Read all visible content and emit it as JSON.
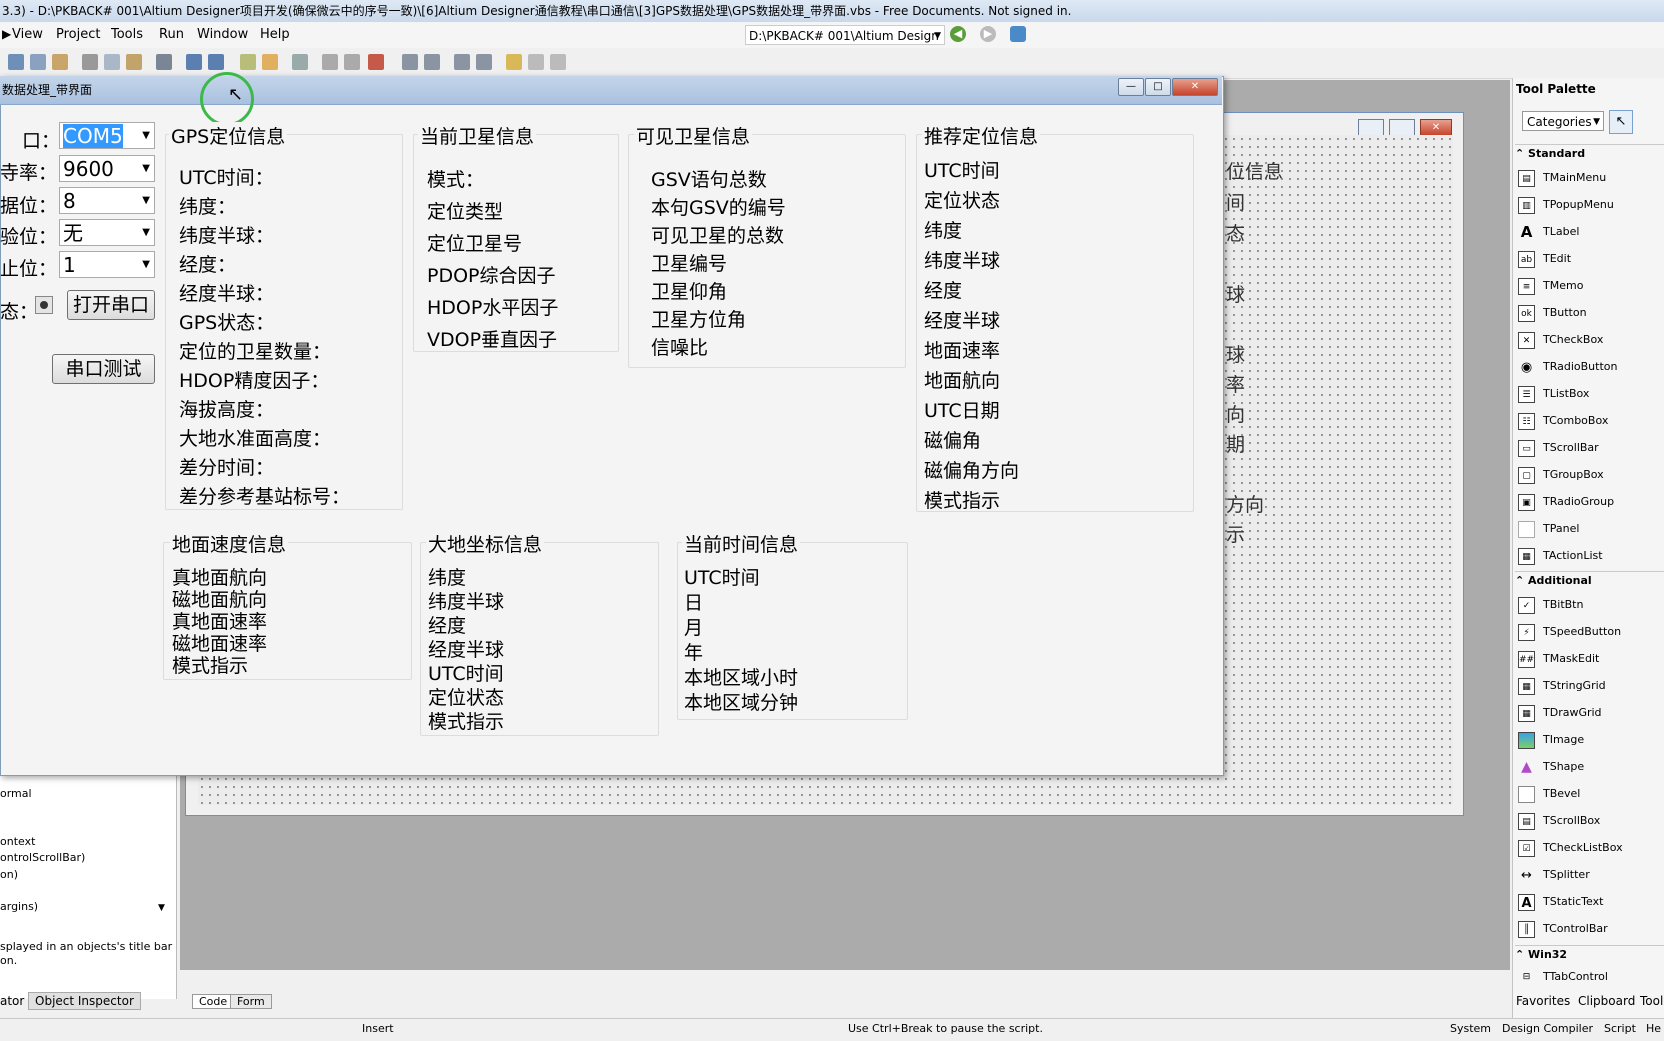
{
  "window": {
    "title": "3.3) - D:\\PKBACK# 001\\Altium Designer项目开发(确保微云中的序号一致)\\[6]Altium Designer通信教程\\串口通信\\[3]GPS数据处理\\GPS数据处理_带界面.vbs - Free Documents. Not signed in."
  },
  "menu": [
    "View",
    "Project",
    "Tools",
    "Run",
    "Window",
    "Help"
  ],
  "toolbar": {
    "path": "D:\\PKBACK# 001\\Altium Design"
  },
  "form": {
    "title": "数据处理_带界面",
    "serial": {
      "port_label": "口：",
      "port_value": "COM5",
      "baud_label": "寺率：",
      "baud_value": "9600",
      "data_label": "据位：",
      "data_value": "8",
      "check_label": "验位：",
      "check_value": "无",
      "stop_label": "止位：",
      "stop_value": "1",
      "state_label": "态：",
      "open_button": "打开串口",
      "test_button": "串口测试"
    },
    "groups": {
      "gps": {
        "title": "GPS定位信息",
        "items": [
          "UTC时间：",
          "纬度：",
          "纬度半球：",
          "经度：",
          "经度半球：",
          "GPS状态：",
          "定位的卫星数量：",
          "HDOP精度因子：",
          "海拔高度：",
          "大地水准面高度：",
          "差分时间：",
          "差分参考基站标号："
        ]
      },
      "current_sat": {
        "title": "当前卫星信息",
        "items": [
          "模式：",
          "定位类型",
          "定位卫星号",
          "PDOP综合因子",
          "HDOP水平因子",
          "VDOP垂直因子"
        ]
      },
      "visible_sat": {
        "title": "可见卫星信息",
        "items": [
          "GSV语句总数",
          "本句GSV的编号",
          "可见卫星的总数",
          "卫星编号",
          "卫星仰角",
          "卫星方位角",
          "信噪比"
        ]
      },
      "recommended": {
        "title": "推荐定位信息",
        "items": [
          "UTC时间",
          "定位状态",
          "纬度",
          "纬度半球",
          "经度",
          "经度半球",
          "地面速率",
          "地面航向",
          "UTC日期",
          "磁偏角",
          "磁偏角方向",
          "模式指示"
        ]
      },
      "ground_speed": {
        "title": "地面速度信息",
        "items": [
          "真地面航向",
          "磁地面航向",
          "真地面速率",
          "磁地面速率",
          "模式指示"
        ]
      },
      "geodetic": {
        "title": "大地坐标信息",
        "items": [
          "纬度",
          "纬度半球",
          "经度",
          "经度半球",
          "UTC时间",
          "定位状态",
          "模式指示"
        ]
      },
      "time": {
        "title": "当前时间信息",
        "items": [
          "UTC时间",
          "日",
          "月",
          "年",
          "本地区域小时",
          "本地区域分钟"
        ]
      }
    }
  },
  "background_labels": [
    "位信息",
    "间",
    "态",
    "球",
    "球",
    "率",
    "向",
    "期",
    "方向",
    "示"
  ],
  "left_panel": {
    "rows": [
      "ormal",
      "ontext",
      "ontrolScrollBar)",
      "on)",
      "argins)"
    ],
    "hint": [
      "splayed in an objects's title bar",
      "on."
    ],
    "tabs": [
      "ator",
      "Object Inspector"
    ]
  },
  "editor_tabs": [
    "Code",
    "Form"
  ],
  "palette": {
    "title": "Tool Palette",
    "category": "Categories",
    "sections": {
      "standard": {
        "name": "Standard",
        "items": [
          "TMainMenu",
          "TPopupMenu",
          "TLabel",
          "TEdit",
          "TMemo",
          "TButton",
          "TCheckBox",
          "TRadioButton",
          "TListBox",
          "TComboBox",
          "TScrollBar",
          "TGroupBox",
          "TRadioGroup",
          "TPanel",
          "TActionList"
        ]
      },
      "additional": {
        "name": "Additional",
        "items": [
          "TBitBtn",
          "TSpeedButton",
          "TMaskEdit",
          "TStringGrid",
          "TDrawGrid",
          "TImage",
          "TShape",
          "TBevel",
          "TScrollBox",
          "TCheckListBox",
          "TSplitter",
          "TStaticText",
          "TControlBar"
        ]
      },
      "win32": {
        "name": "Win32",
        "items": [
          "TTabControl"
        ]
      }
    },
    "tabs": [
      "Favorites",
      "Clipboard",
      "Tool"
    ]
  },
  "status": {
    "mode": "Insert",
    "message": "Use Ctrl+Break to pause the script.",
    "tabs": [
      "System",
      "Design Compiler",
      "Script",
      "He"
    ]
  }
}
